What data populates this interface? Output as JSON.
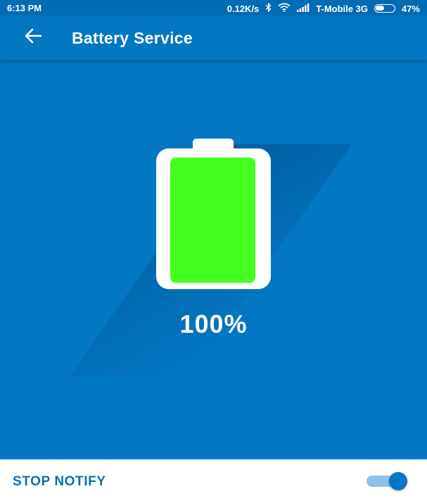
{
  "status_bar": {
    "time": "6:13 PM",
    "network_speed": "0.12K/s",
    "carrier": "T-Mobile 3G",
    "battery_percent": "47%",
    "battery_level": 0.47,
    "icons": [
      "bluetooth-icon",
      "wifi-icon",
      "signal-icon",
      "battery-icon"
    ]
  },
  "app_bar": {
    "title": "Battery Service",
    "back_icon": "arrow-left-icon"
  },
  "battery": {
    "percent_text": "100%",
    "level": 1.0,
    "fill_color": "#43ff1e"
  },
  "bottom_bar": {
    "label": "STOP NOTIFY",
    "toggle_on": true
  },
  "colors": {
    "background": "#0277c2",
    "status_bar": "#006cb3",
    "accent_text": "#0c6fb0",
    "battery_body": "#ffffff"
  }
}
